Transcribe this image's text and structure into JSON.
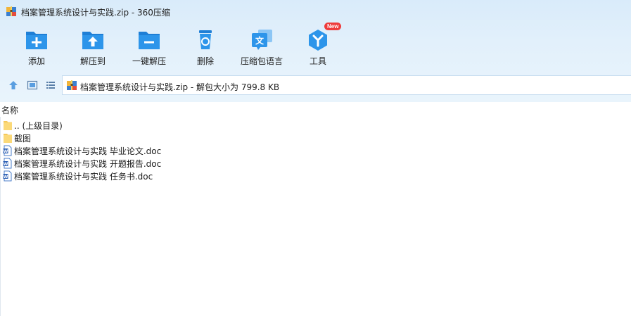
{
  "window": {
    "title": "档案管理系统设计与实践.zip - 360压缩"
  },
  "toolbar": {
    "buttons": [
      {
        "label": "添加",
        "icon": "add-icon"
      },
      {
        "label": "解压到",
        "icon": "extract-to-icon"
      },
      {
        "label": "一键解压",
        "icon": "one-click-extract-icon"
      },
      {
        "label": "删除",
        "icon": "delete-icon"
      },
      {
        "label": "压缩包语言",
        "icon": "language-icon"
      },
      {
        "label": "工具",
        "icon": "tools-icon",
        "badge": "New"
      }
    ]
  },
  "navbar": {
    "path": "档案管理系统设计与实践.zip - 解包大小为 799.8 KB"
  },
  "columns": {
    "name": "名称"
  },
  "files": [
    {
      "name": ".. (上级目录)",
      "type": "folder"
    },
    {
      "name": "截图",
      "type": "folder"
    },
    {
      "name": "档案管理系统设计与实践 毕业论文.doc",
      "type": "doc"
    },
    {
      "name": "档案管理系统设计与实践 开题报告.doc",
      "type": "doc"
    },
    {
      "name": "档案管理系统设计与实践 任务书.doc",
      "type": "doc"
    }
  ],
  "colors": {
    "accent": "#2d8fe0",
    "badge": "#ee3b3b",
    "folder": "#f5c85a"
  }
}
